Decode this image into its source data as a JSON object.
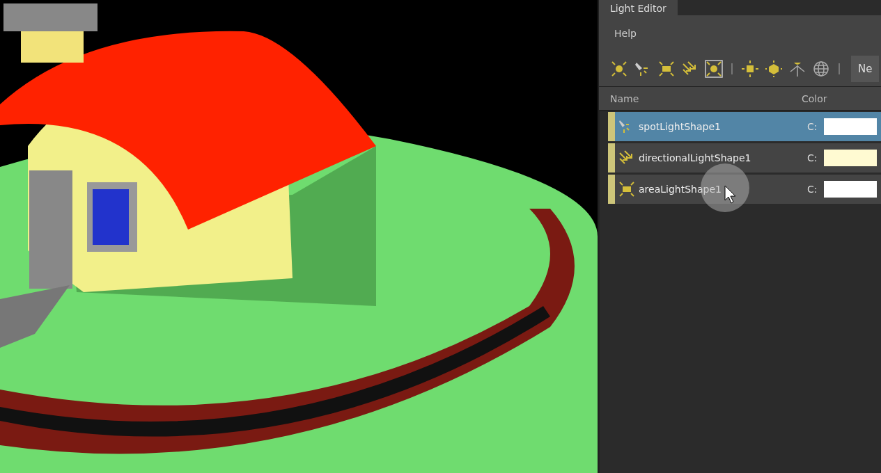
{
  "window": {
    "title": "Light Editor"
  },
  "menu": [
    {
      "label": "Help"
    }
  ],
  "toolbar": {
    "button": "Ne"
  },
  "table": {
    "columns": [
      "Name",
      "Color"
    ],
    "rows": [
      {
        "kind": "spot",
        "name": "spotLightShape1",
        "color_label": "C:",
        "color": "#ffffff",
        "selected": true
      },
      {
        "kind": "directional",
        "name": "directionalLightShape1",
        "color_label": "C:",
        "color": "#fffad2",
        "selected": false
      },
      {
        "kind": "area",
        "name": "areaLightShape1",
        "color_label": "C:",
        "color": "#ffffff",
        "selected": false
      }
    ]
  }
}
